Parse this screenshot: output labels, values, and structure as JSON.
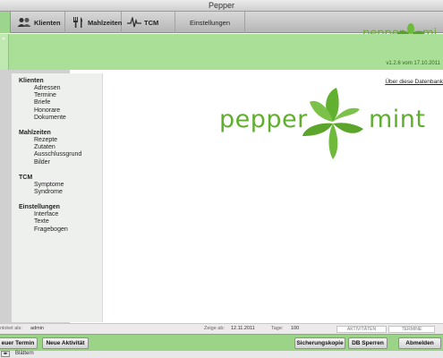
{
  "window": {
    "title": "Pepper"
  },
  "toolbar": {
    "items": [
      {
        "label": "Klienten",
        "icon": "people-icon"
      },
      {
        "label": "Mahlzeiten",
        "icon": "cutlery-icon"
      },
      {
        "label": "TCM",
        "icon": "pulse-icon"
      },
      {
        "label": "Einstellungen",
        "icon": ""
      }
    ]
  },
  "brand": {
    "word1": "pepper",
    "word2": "mint",
    "top_word1": "pepper",
    "top_word2": "mi",
    "color": "#5fae2e"
  },
  "version": "v1.2.6 vom 17.10.2011",
  "about_link": "Über diese Datenbank",
  "menu": {
    "sections": [
      {
        "title": "Klienten",
        "items": [
          "Adressen",
          "Termine",
          "Briefe",
          "Honorare",
          "Dokumente"
        ]
      },
      {
        "title": "Mahlzeiten",
        "items": [
          "Rezepte",
          "Zutaten",
          "Ausschlussgrund",
          "Bilder"
        ]
      },
      {
        "title": "TCM",
        "items": [
          "Symptome",
          "Syndrome"
        ]
      },
      {
        "title": "Einstellungen",
        "items": [
          "Interface",
          "Texte",
          "Fragebogen"
        ]
      }
    ]
  },
  "status": {
    "login_label": "nloket als:",
    "login_user": "admin",
    "show_label": "Zeige ab:",
    "show_date": "12.11.2011",
    "days_label": "Tage:",
    "days_value": "100",
    "btn_activities": "AKTIVITÄTEN",
    "btn_appointments": "TERMINE"
  },
  "bottom": {
    "new_appointment": "euer Termin",
    "new_activity": "Neue Aktivität",
    "backup": "Sicherungskopie",
    "db_lock": "DB Sperren",
    "logout": "Abmelden"
  },
  "footer": {
    "browse": "Blättern"
  }
}
